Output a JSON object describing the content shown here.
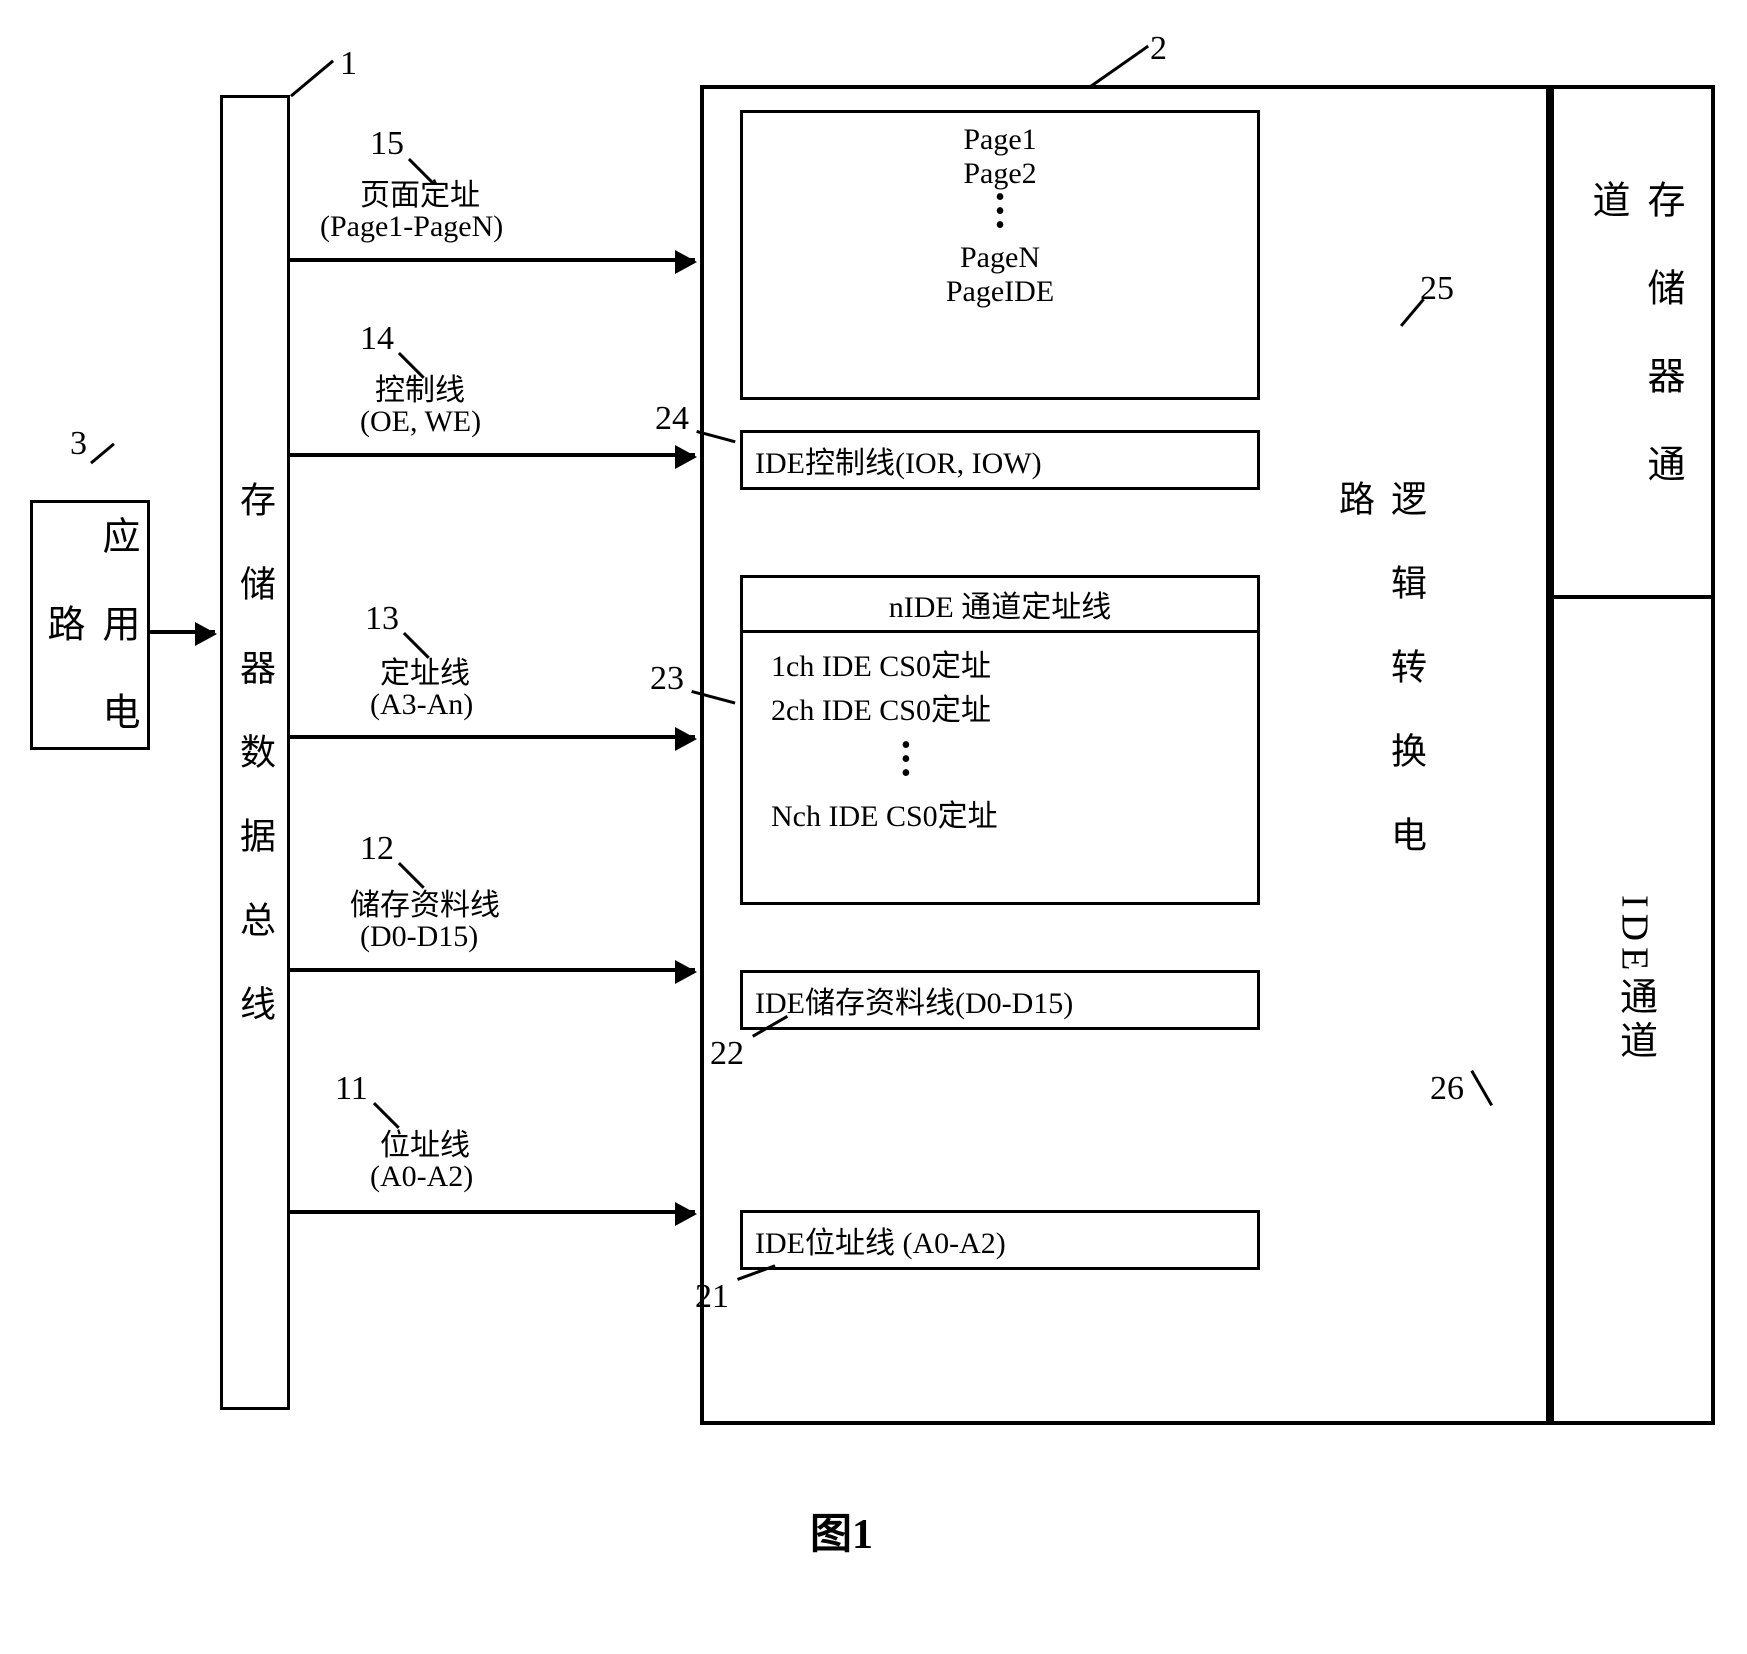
{
  "blocks": {
    "app_circuit": "应\n用\n电\n路",
    "mem_bus": "存\n储\n器\n数\n据\n总\n线",
    "logic_conv": "逻\n辑\n转\n换\n电\n路",
    "mem_channel": "存\n储\n器\n通\n道",
    "ide_channel": "I\nD\nE\n通\n道"
  },
  "nums": {
    "n1": "1",
    "n2": "2",
    "n3": "3",
    "n11": "11",
    "n12": "12",
    "n13": "13",
    "n14": "14",
    "n15": "15",
    "n21": "21",
    "n22": "22",
    "n23": "23",
    "n24": "24",
    "n25": "25",
    "n26": "26"
  },
  "signals": {
    "s15a": "页面定址",
    "s15b": "(Page1-PageN)",
    "s14a": "控制线",
    "s14b": "(OE, WE)",
    "s13a": "定址线",
    "s13b": "(A3-An)",
    "s12a": "储存资料线",
    "s12b": "(D0-D15)",
    "s11a": "位址线",
    "s11b": "(A0-A2)"
  },
  "pages": {
    "p1": "Page1",
    "p2": "Page2",
    "pn": "PageN",
    "pide": "PageIDE"
  },
  "ide": {
    "ctrl": "IDE控制线(IOR, IOW)",
    "chan_header": "nIDE 通道定址线",
    "ch1": "1ch IDE CS0定址",
    "ch2": "2ch IDE CS0定址",
    "chn": "Nch IDE CS0定址",
    "data": "IDE储存资料线(D0-D15)",
    "addr": "IDE位址线 (A0-A2)"
  },
  "caption": "图1"
}
